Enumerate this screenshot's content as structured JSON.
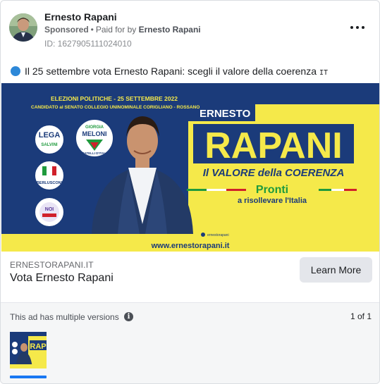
{
  "advertiser": {
    "name": "Ernesto Rapani",
    "sponsored": "Sponsored",
    "separator": "•",
    "paid_for_by_prefix": "Paid for by",
    "paid_for_by": "Ernesto Rapani",
    "library_id": "ID: 1627905111024010",
    "more_icon": "more-horizontal-icon"
  },
  "ad_text": {
    "icon": "blue-circle-emoji-icon",
    "text": "Il 25 settembre vota Ernesto Rapani: scegli il valore della coerenza",
    "flag": "IT"
  },
  "creative": {
    "headline": "ELEZIONI POLITICHE - 25 SETTEMBRE 2022",
    "subline": "CANDIDATO al SENATO COLLEGIO UNINOMINALE CORIGLIANO - ROSSANO",
    "first_name": "ERNESTO",
    "last_name": "RAPANI",
    "slogan": "Il VALORE della COERENZA",
    "pronti": "Pronti",
    "risollevare": "a risollevare l'Italia",
    "social": "ernestorapani",
    "website": "www.ernestorapani.it",
    "logos": {
      "lega_top": "LEGA",
      "lega_bottom": "SALVINI",
      "fdi_top": "GIORGIA",
      "fdi_name": "MELONI",
      "fdi_bottom": "FRATELLI D'ITALIA",
      "fi": "BERLUSCONI",
      "nm": "NOI"
    },
    "colors": {
      "navy": "#1b3b7a",
      "yellow": "#f5e94a",
      "tricolor_green": "#1f9a3d",
      "tricolor_red": "#d0202a"
    }
  },
  "link": {
    "domain": "ERNESTORAPANI.IT",
    "title": "Vota Ernesto Rapani",
    "cta": "Learn More"
  },
  "versions": {
    "label": "This ad has multiple versions",
    "info_icon": "info-icon",
    "info_glyph": "i",
    "pager": "1 of 1",
    "selected_color": "#1877f2"
  }
}
